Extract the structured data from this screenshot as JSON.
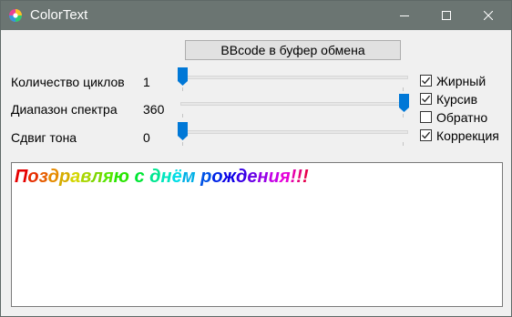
{
  "window": {
    "title": "ColorText",
    "background": "#f0f0f0",
    "titlebar_color": "#6b7572"
  },
  "toolbar": {
    "copy_bbcode_label": "BBcode в буфер обмена"
  },
  "sliders": [
    {
      "label": "Количество циклов",
      "value": "1",
      "min": 1,
      "max": 100,
      "position": 0.0
    },
    {
      "label": "Диапазон спектра",
      "value": "360",
      "min": 0,
      "max": 360,
      "position": 1.0
    },
    {
      "label": "Сдвиг тона",
      "value": "0",
      "min": 0,
      "max": 360,
      "position": 0.0
    }
  ],
  "options": [
    {
      "label": "Жирный",
      "checked": true
    },
    {
      "label": "Курсив",
      "checked": true
    },
    {
      "label": "Обратно",
      "checked": false
    },
    {
      "label": "Коррекция",
      "checked": true
    }
  ],
  "output": {
    "text": "Поздравляю с днём рождения!!!"
  },
  "icons": {
    "app": "color-wheel-icon",
    "minimize": "minimize-icon",
    "maximize": "maximize-icon",
    "close": "close-icon"
  },
  "accent_color": "#0078d7"
}
